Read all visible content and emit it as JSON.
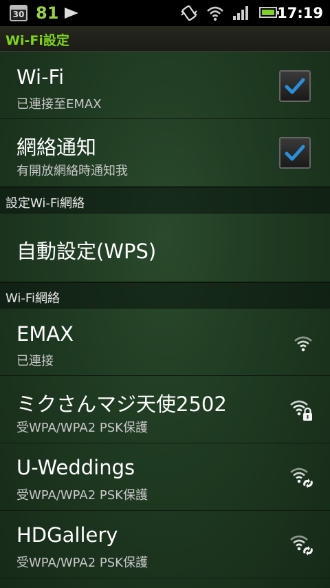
{
  "status_bar": {
    "calendar_day": "30",
    "battery_level": "81",
    "time": "17:19",
    "icons": [
      "calendar-icon",
      "media-play-icon",
      "vibrate-icon",
      "wifi-icon",
      "signal-icon",
      "battery-icon"
    ]
  },
  "title": "Wi-Fi設定",
  "settings": [
    {
      "title": "Wi-Fi",
      "summary": "已連接至EMAX",
      "checked": true
    },
    {
      "title": "網絡通知",
      "summary": "有開放網絡時通知我",
      "checked": true
    }
  ],
  "section_setup": "設定Wi-Fi網絡",
  "wps": {
    "title": "自動設定(WPS)"
  },
  "section_networks": "Wi-Fi網絡",
  "networks": [
    {
      "ssid": "EMAX",
      "status": "已連接",
      "icon": "wifi-signal-icon"
    },
    {
      "ssid": "ミクさんマジ天使2502",
      "status": "受WPA/WPA2 PSK保護",
      "icon": "wifi-locked-icon"
    },
    {
      "ssid": "U-Weddings",
      "status": "受WPA/WPA2 PSK保護",
      "icon": "wifi-wps-icon"
    },
    {
      "ssid": "HDGallery",
      "status": "受WPA/WPA2 PSK保護",
      "icon": "wifi-wps-icon"
    }
  ],
  "colors": {
    "accent_green": "#7ed321",
    "checkmark_blue": "#2a8fd6",
    "background": "#1f3a22"
  }
}
